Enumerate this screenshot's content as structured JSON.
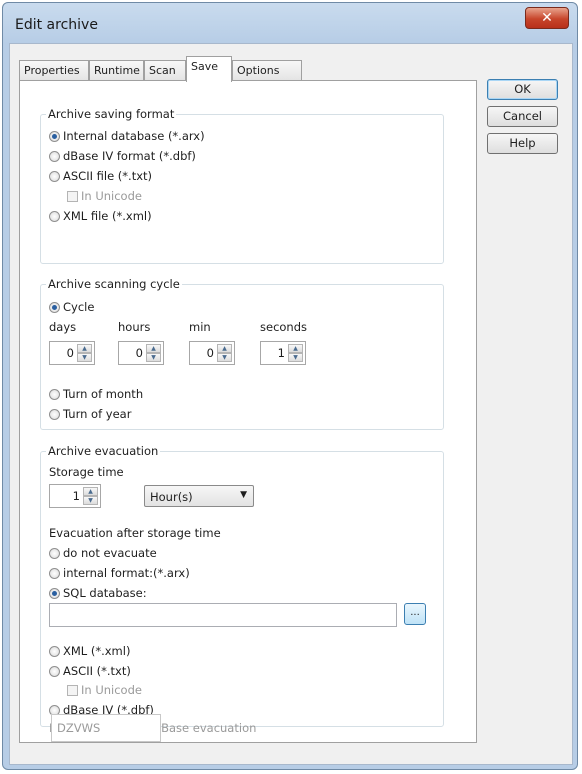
{
  "window": {
    "title": "Edit archive",
    "close_glyph": "✕"
  },
  "tabs": [
    "Properties",
    "Runtime",
    "Scan",
    "Save",
    "Options"
  ],
  "active_tab": "Save",
  "buttons": {
    "ok": "OK",
    "cancel": "Cancel",
    "help": "Help"
  },
  "saving_format": {
    "title": "Archive saving format",
    "options": [
      "Internal database (*.arx)",
      "dBase IV format (*.dbf)",
      "ASCII file (*.txt)",
      "XML file (*.xml)"
    ],
    "selected": "Internal database (*.arx)",
    "unicode_label": "In Unicode"
  },
  "scanning_cycle": {
    "title": "Archive scanning cycle",
    "cycle_label": "Cycle",
    "fields": [
      {
        "label": "days",
        "value": "0"
      },
      {
        "label": "hours",
        "value": "0"
      },
      {
        "label": "min",
        "value": "0"
      },
      {
        "label": "seconds",
        "value": "1"
      }
    ],
    "turn_month": "Turn of month",
    "turn_year": "Turn of year",
    "selected": "Cycle"
  },
  "evacuation": {
    "title": "Archive evacuation",
    "storage_label": "Storage time",
    "storage_value": "1",
    "unit": "Hour(s)",
    "after_label": "Evacuation after storage time",
    "opt_none": "do not evacuate",
    "opt_internal": "internal format:(*.arx)",
    "opt_sql": "SQL database:",
    "sql_path": "",
    "browse": "...",
    "opt_xml": "XML (*.xml)",
    "opt_ascii": "ASCII (*.txt)",
    "unicode_label": "In Unicode",
    "opt_dbase": "dBase IV (*.dbf)",
    "format_label": "Format for ASCII / dBase evacuation",
    "format_value": "DZVWS",
    "selected": "SQL database:"
  },
  "colors": {
    "title_bar": "#b7cde6",
    "close": "#c7452b",
    "radio_selected": "#2a5fa0"
  }
}
